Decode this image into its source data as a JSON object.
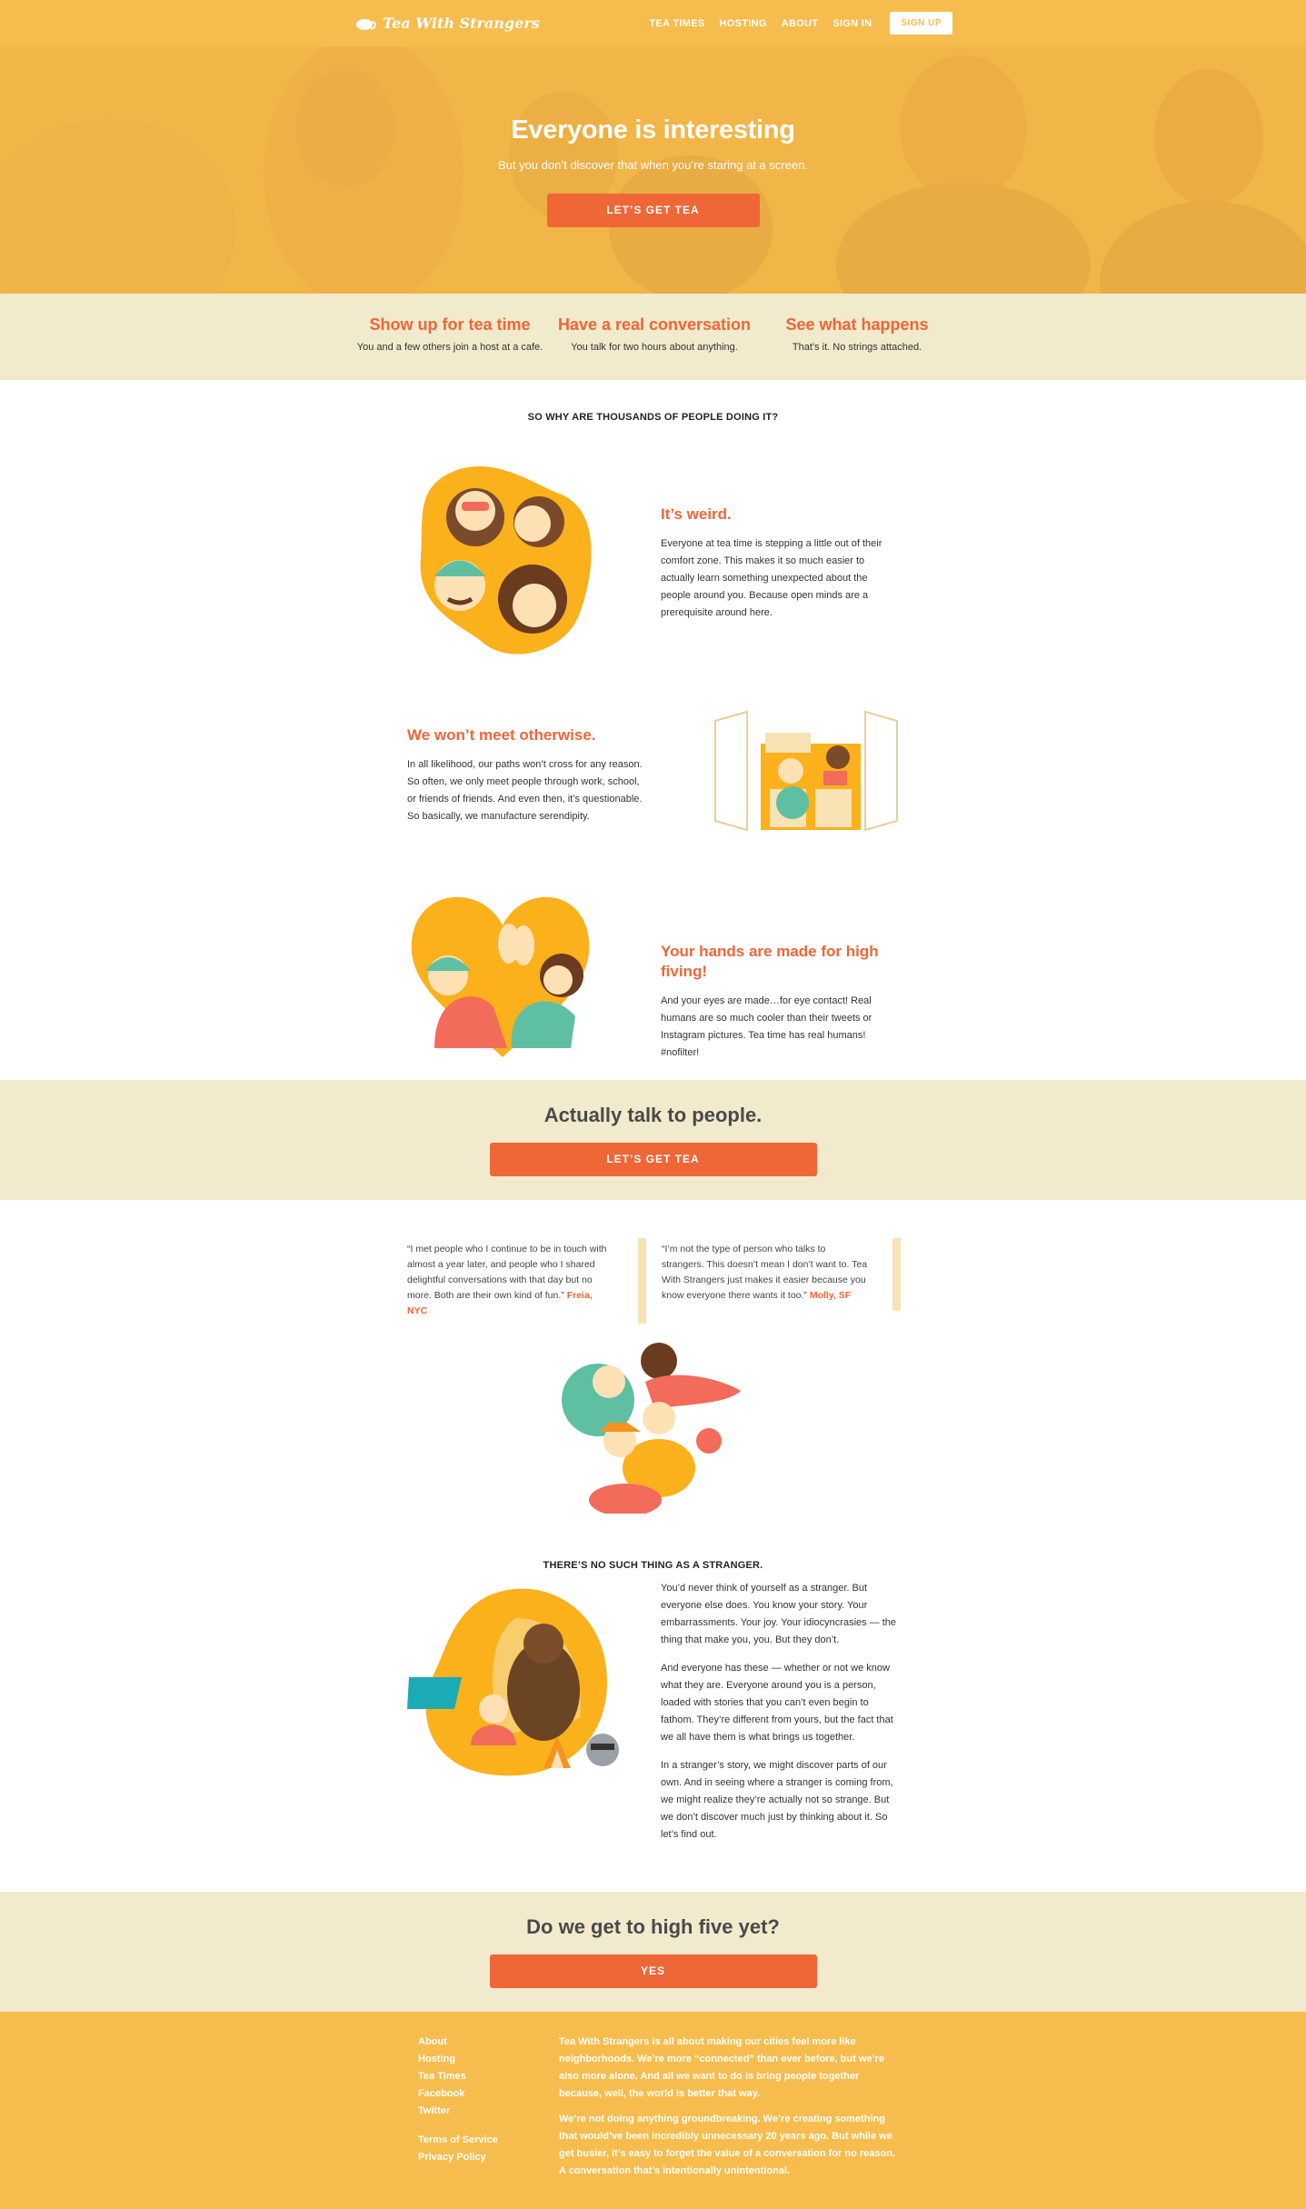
{
  "nav": {
    "logo_text": "Tea With Strangers",
    "links": [
      "TEA TIMES",
      "HOSTING",
      "ABOUT",
      "SIGN IN"
    ],
    "signup_label": "SIGN UP"
  },
  "hero": {
    "title": "Everyone is interesting",
    "subtitle": "But you don’t discover that when you’re staring at a screen.",
    "cta_label": "LET’S GET TEA"
  },
  "steps": [
    {
      "title": "Show up for tea time",
      "text": "You and a few others join a host at a cafe."
    },
    {
      "title": "Have a real conversation",
      "text": "You talk for two hours about anything."
    },
    {
      "title": "See what happens",
      "text": "That’s it. No strings attached."
    }
  ],
  "why": {
    "heading": "SO WHY ARE THOUSANDS OF PEOPLE DOING IT?",
    "reasons": [
      {
        "title": "It’s weird.",
        "text": "Everyone at tea time is stepping a little out of their comfort zone. This makes it so much easier to actually learn something unexpected about the people around you. Because open minds are a prerequisite around here."
      },
      {
        "title": "We won’t meet otherwise.",
        "text": "In all likelihood, our paths won’t cross for any reason. So often, we only meet people through work, school, or friends of friends. And even then, it’s questionable. So basically, we manufacture serendipity."
      },
      {
        "title": "Your hands are made for high fiving!",
        "text": "And your eyes are made…for eye contact! Real humans are so much cooler than their tweets or Instagram pictures. Tea time has real humans! #nofilter!"
      }
    ]
  },
  "cta1": {
    "title": "Actually talk to people.",
    "button": "LET’S GET TEA"
  },
  "quotes": [
    {
      "text": "“I met people who I continue to be in touch with almost a year later, and people who I shared delightful conversations with that day but no more. Both are their own kind of fun.”",
      "author": "Freia, NYC"
    },
    {
      "text": "“I’m not the type of person who talks to strangers. This doesn’t mean I don’t want to. Tea With Strangers just makes it easier because you know everyone there wants it too.”",
      "author": "Molly, SF"
    }
  ],
  "stranger": {
    "heading": "THERE’S NO SUCH THING AS A STRANGER.",
    "paragraphs": [
      "You’d never think of yourself as a stranger. But everyone else does. You know your story. Your embarrassments. Your joy. Your idiocyncrasies — the thing that make you, you. But they don’t.",
      "And everyone has these — whether or not we know what they are. Everyone around you is a person, loaded with stories that you can’t even begin to fathom. They’re different from yours, but the fact that we all have them is what brings us together.",
      "In a stranger’s story, we might discover parts of our own. And in seeing where a stranger is coming from, we might realize they’re actually not so strange. But we don’t discover much just by thinking about it. So let’s find out."
    ]
  },
  "cta2": {
    "title": "Do we get to high five yet?",
    "button": "YES"
  },
  "footer": {
    "links": [
      "About",
      "Hosting",
      "Tea Times",
      "Facebook",
      "Twitter"
    ],
    "legal_links": [
      "Terms of Service",
      "Privacy Policy"
    ],
    "paragraphs": [
      "Tea With Strangers is all about making our cities feel more like neighborhoods. We’re more “connected” than ever before, but we’re also more alone. And all we want to do is bring people together because, well, the world is better that way.",
      "We’re not doing anything groundbreaking. We’re creating something that would’ve been incredibly unnecessary 20 years ago. But while we get busier, it’s easy to forget the value of a conversation for no reason. A conversation that’s intentionally unintentional."
    ]
  },
  "colors": {
    "brand_yellow": "#f6bd4e",
    "accent_orange": "#ef6637",
    "cream": "#f2eacd"
  }
}
